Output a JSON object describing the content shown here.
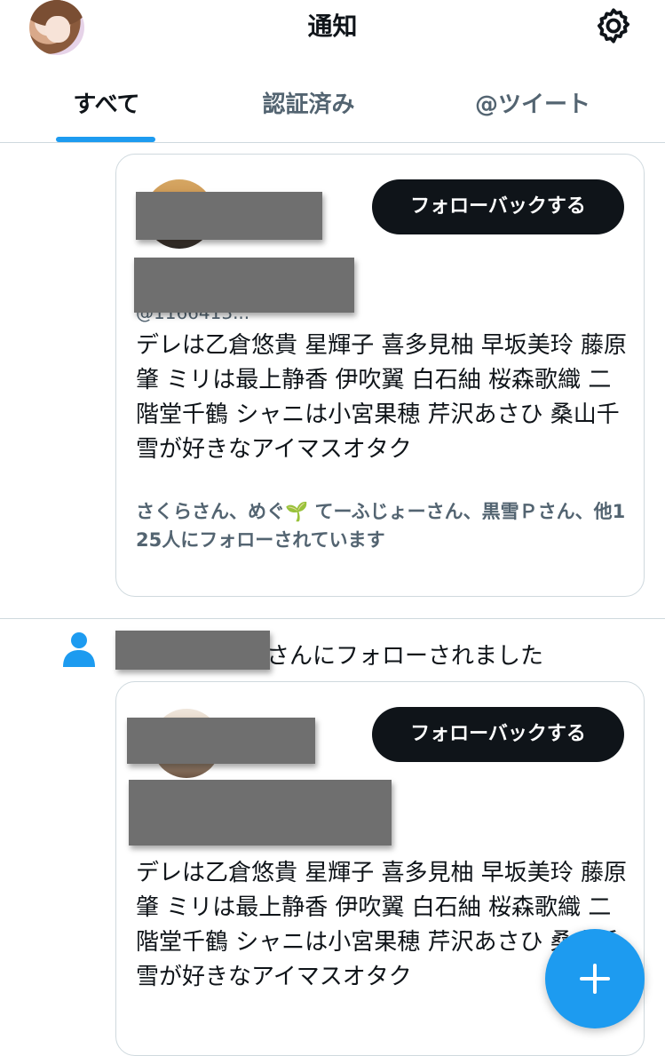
{
  "header": {
    "title": "通知",
    "avatar_icon": "user-avatar",
    "settings_icon": "gear-icon"
  },
  "tabs": [
    {
      "label": "すべて",
      "active": true
    },
    {
      "label": "認証済み",
      "active": false
    },
    {
      "label": "@ツイート",
      "active": false
    }
  ],
  "cards": [
    {
      "follow_button": "フォローバックする",
      "handle_partial": "@1166413...",
      "bio": "デレは乙倉悠貴 星輝子 喜多見柚 早坂美玲 藤原肇 ミリは最上静香 伊吹翼 白石紬 桜森歌織 二階堂千鶴 シャニは小宮果穂 芹沢あさひ 桑山千雪が好きなアイマスオタク",
      "followed_by": "さくらさん、めぐ🌱 てーふじょーさん、黒雪Ｐさん、他125人にフォローされています"
    },
    {
      "follow_button": "フォローバックする",
      "bio": "デレは乙倉悠貴 星輝子 喜多見柚 早坂美玲 藤原肇 ミリは最上静香 伊吹翼 白石紬 桜森歌織 二階堂千鶴 シャニは小宮果穂 芹沢あさひ 桑山千雪が好きなアイマスオタク"
    }
  ],
  "notification": {
    "text": "さんにフォローされました",
    "icon": "person-icon"
  },
  "fab": {
    "icon": "plus-icon",
    "color": "#1d9bf0"
  },
  "colors": {
    "accent": "#1d9bf0",
    "button_bg": "#0f1419",
    "secondary_text": "#536471"
  }
}
